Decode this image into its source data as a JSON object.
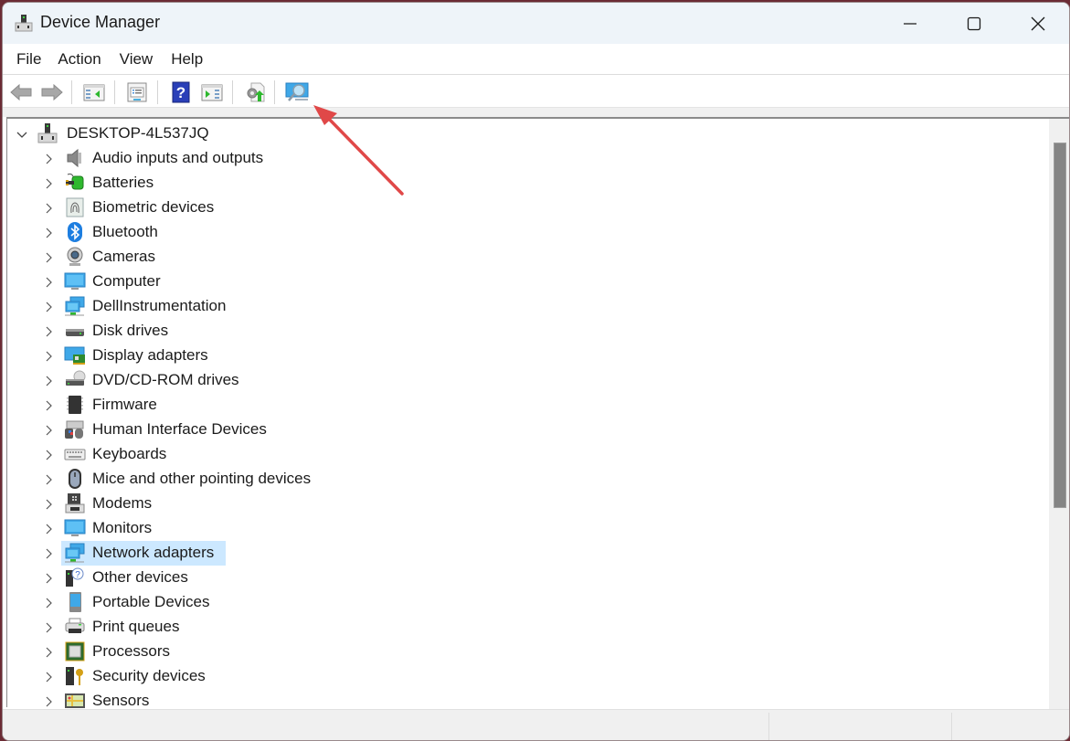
{
  "window": {
    "title": "Device Manager",
    "controls": {
      "minimize": "minimize",
      "maximize": "maximize",
      "close": "close"
    }
  },
  "menu": {
    "items": [
      "File",
      "Action",
      "View",
      "Help"
    ]
  },
  "toolbar": {
    "buttons": [
      {
        "name": "back",
        "icon": "back-arrow-icon",
        "enabled": false
      },
      {
        "name": "forward",
        "icon": "forward-arrow-icon",
        "enabled": false
      },
      {
        "name": "show-hide-console-tree",
        "icon": "console-tree-icon"
      },
      {
        "name": "properties",
        "icon": "properties-icon"
      },
      {
        "name": "help",
        "icon": "help-icon"
      },
      {
        "name": "show-hide-action-pane",
        "icon": "action-pane-icon"
      },
      {
        "name": "update-driver",
        "icon": "update-driver-icon"
      },
      {
        "name": "scan-for-hardware-changes",
        "icon": "scan-hardware-icon"
      }
    ]
  },
  "tree": {
    "root": {
      "label": "DESKTOP-4L537JQ",
      "expanded": true,
      "icon": "computer-tower-icon"
    },
    "items": [
      {
        "label": "Audio inputs and outputs",
        "icon": "speaker-icon"
      },
      {
        "label": "Batteries",
        "icon": "battery-icon"
      },
      {
        "label": "Biometric devices",
        "icon": "fingerprint-icon"
      },
      {
        "label": "Bluetooth",
        "icon": "bluetooth-icon"
      },
      {
        "label": "Cameras",
        "icon": "webcam-icon"
      },
      {
        "label": "Computer",
        "icon": "monitor-icon"
      },
      {
        "label": "DellInstrumentation",
        "icon": "network-icon"
      },
      {
        "label": "Disk drives",
        "icon": "disk-drive-icon"
      },
      {
        "label": "Display adapters",
        "icon": "display-adapter-icon"
      },
      {
        "label": "DVD/CD-ROM drives",
        "icon": "dvd-drive-icon"
      },
      {
        "label": "Firmware",
        "icon": "chip-icon"
      },
      {
        "label": "Human Interface Devices",
        "icon": "hid-icon"
      },
      {
        "label": "Keyboards",
        "icon": "keyboard-icon"
      },
      {
        "label": "Mice and other pointing devices",
        "icon": "mouse-icon"
      },
      {
        "label": "Modems",
        "icon": "modem-icon"
      },
      {
        "label": "Monitors",
        "icon": "monitor-icon"
      },
      {
        "label": "Network adapters",
        "icon": "network-icon",
        "selected": true
      },
      {
        "label": "Other devices",
        "icon": "unknown-device-icon"
      },
      {
        "label": "Portable Devices",
        "icon": "portable-device-icon"
      },
      {
        "label": "Print queues",
        "icon": "printer-icon"
      },
      {
        "label": "Processors",
        "icon": "processor-icon"
      },
      {
        "label": "Security devices",
        "icon": "security-device-icon"
      },
      {
        "label": "Sensors",
        "icon": "sensor-icon"
      }
    ]
  },
  "colors": {
    "titlebar_bg": "#eef4f9",
    "selection_bg": "#cce8ff",
    "annotation_arrow": "#e04848"
  }
}
